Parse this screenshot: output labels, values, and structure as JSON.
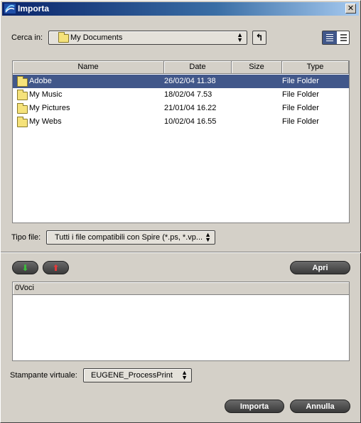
{
  "window": {
    "title": "Importa",
    "close_glyph": "✕"
  },
  "lookin": {
    "label": "Cerca in:",
    "value": "My Documents",
    "up_icon": "arrow-up-folder-icon"
  },
  "view_toggle": {
    "icon": "list-view-icon"
  },
  "columns": [
    "Name",
    "Date",
    "Size",
    "Type"
  ],
  "files": [
    {
      "name": "Adobe",
      "date": "26/02/04 11.38",
      "size": "",
      "type": "File Folder",
      "selected": true
    },
    {
      "name": "My Music",
      "date": "18/02/04 7.53",
      "size": "",
      "type": "File Folder",
      "selected": false
    },
    {
      "name": "My Pictures",
      "date": "21/01/04 16.22",
      "size": "",
      "type": "File Folder",
      "selected": false
    },
    {
      "name": "My Webs",
      "date": "10/02/04 16.55",
      "size": "",
      "type": "File Folder",
      "selected": false
    }
  ],
  "filetype": {
    "label": "Tipo file:",
    "value": "Tutti i file compatibili con Spire (*.ps, *.vp..."
  },
  "queue": {
    "open_label": "Apri",
    "header": "0Voci"
  },
  "printer": {
    "label": "Stampante virtuale:",
    "value": "EUGENE_ProcessPrint"
  },
  "footer": {
    "import_label": "Importa",
    "cancel_label": "Annulla"
  },
  "colors": {
    "selection": "#41578a",
    "titlebar": "#0a246a",
    "pill": "#3a3a3a"
  }
}
